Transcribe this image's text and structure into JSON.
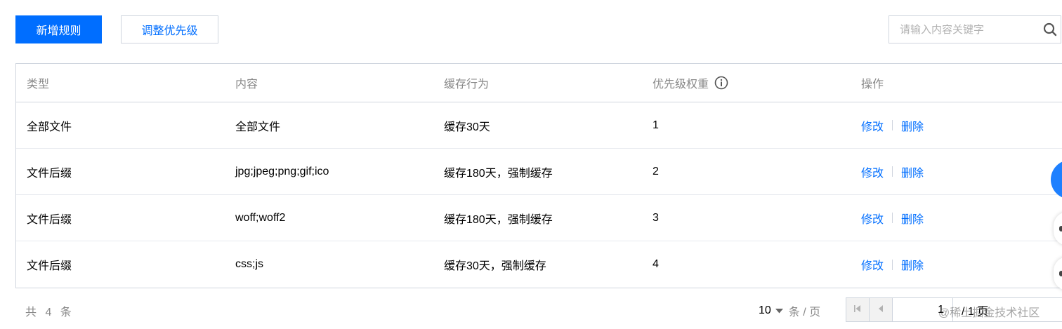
{
  "toolbar": {
    "add_rule_label": "新增规则",
    "adjust_priority_label": "调整优先级"
  },
  "search": {
    "placeholder": "请输入内容关键字",
    "icon": "search-icon"
  },
  "table": {
    "columns": [
      "类型",
      "内容",
      "缓存行为",
      "优先级权重",
      "操作"
    ],
    "priority_info_icon": "info-icon",
    "rows": [
      {
        "type": "全部文件",
        "content": "全部文件",
        "behavior": "缓存30天",
        "priority": "1",
        "edit": "修改",
        "delete": "删除"
      },
      {
        "type": "文件后缀",
        "content": "jpg;jpeg;png;gif;ico",
        "behavior": "缓存180天，强制缓存",
        "priority": "2",
        "edit": "修改",
        "delete": "删除"
      },
      {
        "type": "文件后缀",
        "content": "woff;woff2",
        "behavior": "缓存180天，强制缓存",
        "priority": "3",
        "edit": "修改",
        "delete": "删除"
      },
      {
        "type": "文件后缀",
        "content": "css;js",
        "behavior": "缓存30天，强制缓存",
        "priority": "4",
        "edit": "修改",
        "delete": "删除"
      }
    ]
  },
  "footer": {
    "total_text": "共 4 条",
    "page_size": "10",
    "page_size_unit": "条 / 页",
    "current_page": "1",
    "total_pages": "/ 1 页"
  },
  "watermark": "@稀土掘金技术社区",
  "colors": {
    "primary": "#006eff",
    "border": "#cfd5de",
    "muted_text": "#888888",
    "float_button": "#1e80ff"
  }
}
